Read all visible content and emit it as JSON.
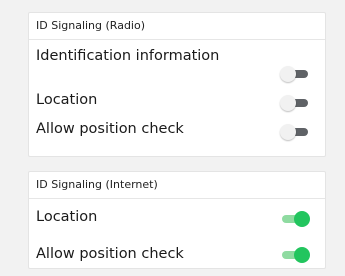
{
  "radio": {
    "header": "ID Signaling (Radio)",
    "items": [
      {
        "label": "Identification information",
        "enabled": false
      },
      {
        "label": "Location",
        "enabled": false
      },
      {
        "label": "Allow position check",
        "enabled": false
      }
    ]
  },
  "internet": {
    "header": "ID Signaling (Internet)",
    "items": [
      {
        "label": "Location",
        "enabled": true
      },
      {
        "label": "Allow position check",
        "enabled": true
      }
    ]
  },
  "colors": {
    "toggle_on": "#22c55e",
    "toggle_on_track": "#8fdba1",
    "toggle_off_track": "#5f6266",
    "toggle_off_thumb": "#f1f1f1"
  }
}
